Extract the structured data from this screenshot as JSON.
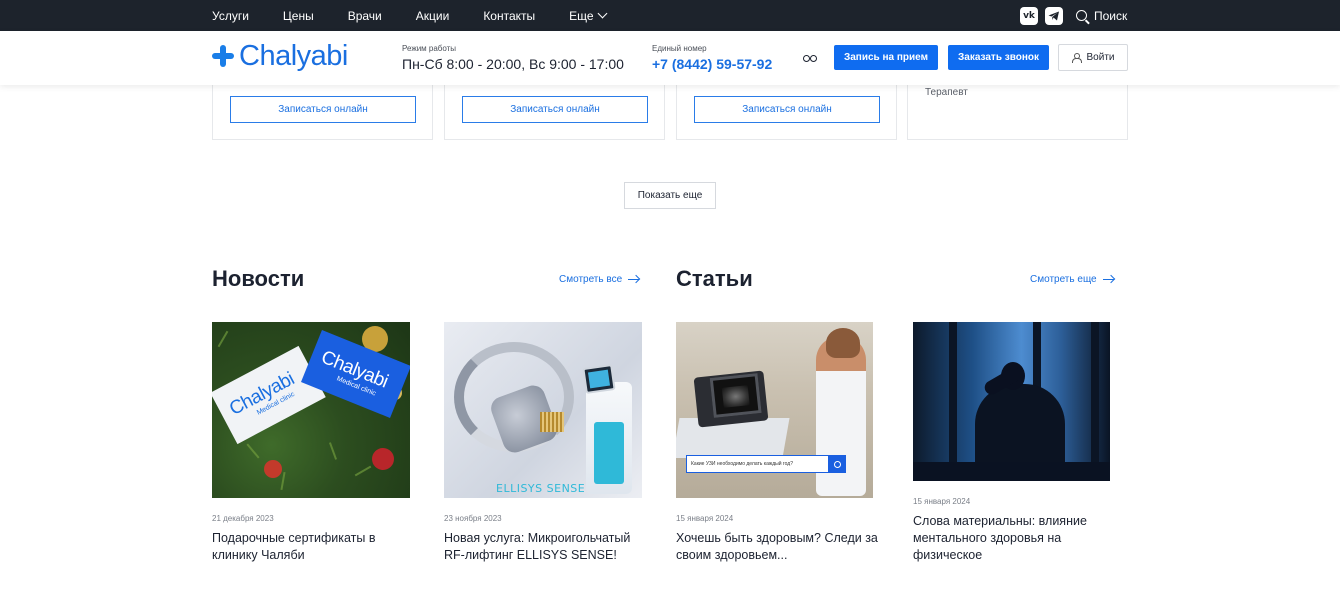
{
  "topbar": {
    "nav": [
      "Услуги",
      "Цены",
      "Врачи",
      "Акции",
      "Контакты"
    ],
    "more": "Еще",
    "social": {
      "vk": "vk-icon",
      "telegram": "telegram-icon"
    },
    "search_label": "Поиск"
  },
  "header": {
    "logo": "Chalyabi",
    "hours_label": "Режим работы",
    "hours_value": "Пн-Сб 8:00 - 20:00, Вс 9:00 - 17:00",
    "phone_label": "Единый номер",
    "phone_value": "+7 (8442) 59-57-92",
    "vision_icon": "glasses-icon",
    "appoint_button": "Запись на прием",
    "call_button": "Заказать звонок",
    "login_button": "Войти"
  },
  "doctors": {
    "online_button": "Записаться онлайн",
    "last_card_specialty": "Терапевт",
    "show_more": "Показать еще"
  },
  "news": {
    "title": "Новости",
    "see_all": "Смотреть все",
    "items": [
      {
        "date": "21 декабря 2023",
        "title": "Подарочные сертификаты в клинику Чаляби",
        "image_brand": "Chalyabi",
        "image_sub": "Medical clinic"
      },
      {
        "date": "23 ноября 2023",
        "title": "Новая услуга: Микроигольчатый RF-лифтинг ELLISYS SENSE!",
        "image_brand": "ELLISYS SENSE"
      }
    ]
  },
  "articles": {
    "title": "Статьи",
    "see_more": "Смотреть еще",
    "items": [
      {
        "date": "15 января 2024",
        "title": "Хочешь быть здоровым? Следи за своим здоровьем...",
        "image_query": "Какие УЗИ необходимо делать каждый год?"
      },
      {
        "date": "15 января 2024",
        "title": "Слова материальны: влияние ментального здоровья на физическое"
      }
    ]
  },
  "colors": {
    "brand_blue": "#0f6cf0",
    "topbar_bg": "#1d232c",
    "text_dark": "#1c2230"
  }
}
